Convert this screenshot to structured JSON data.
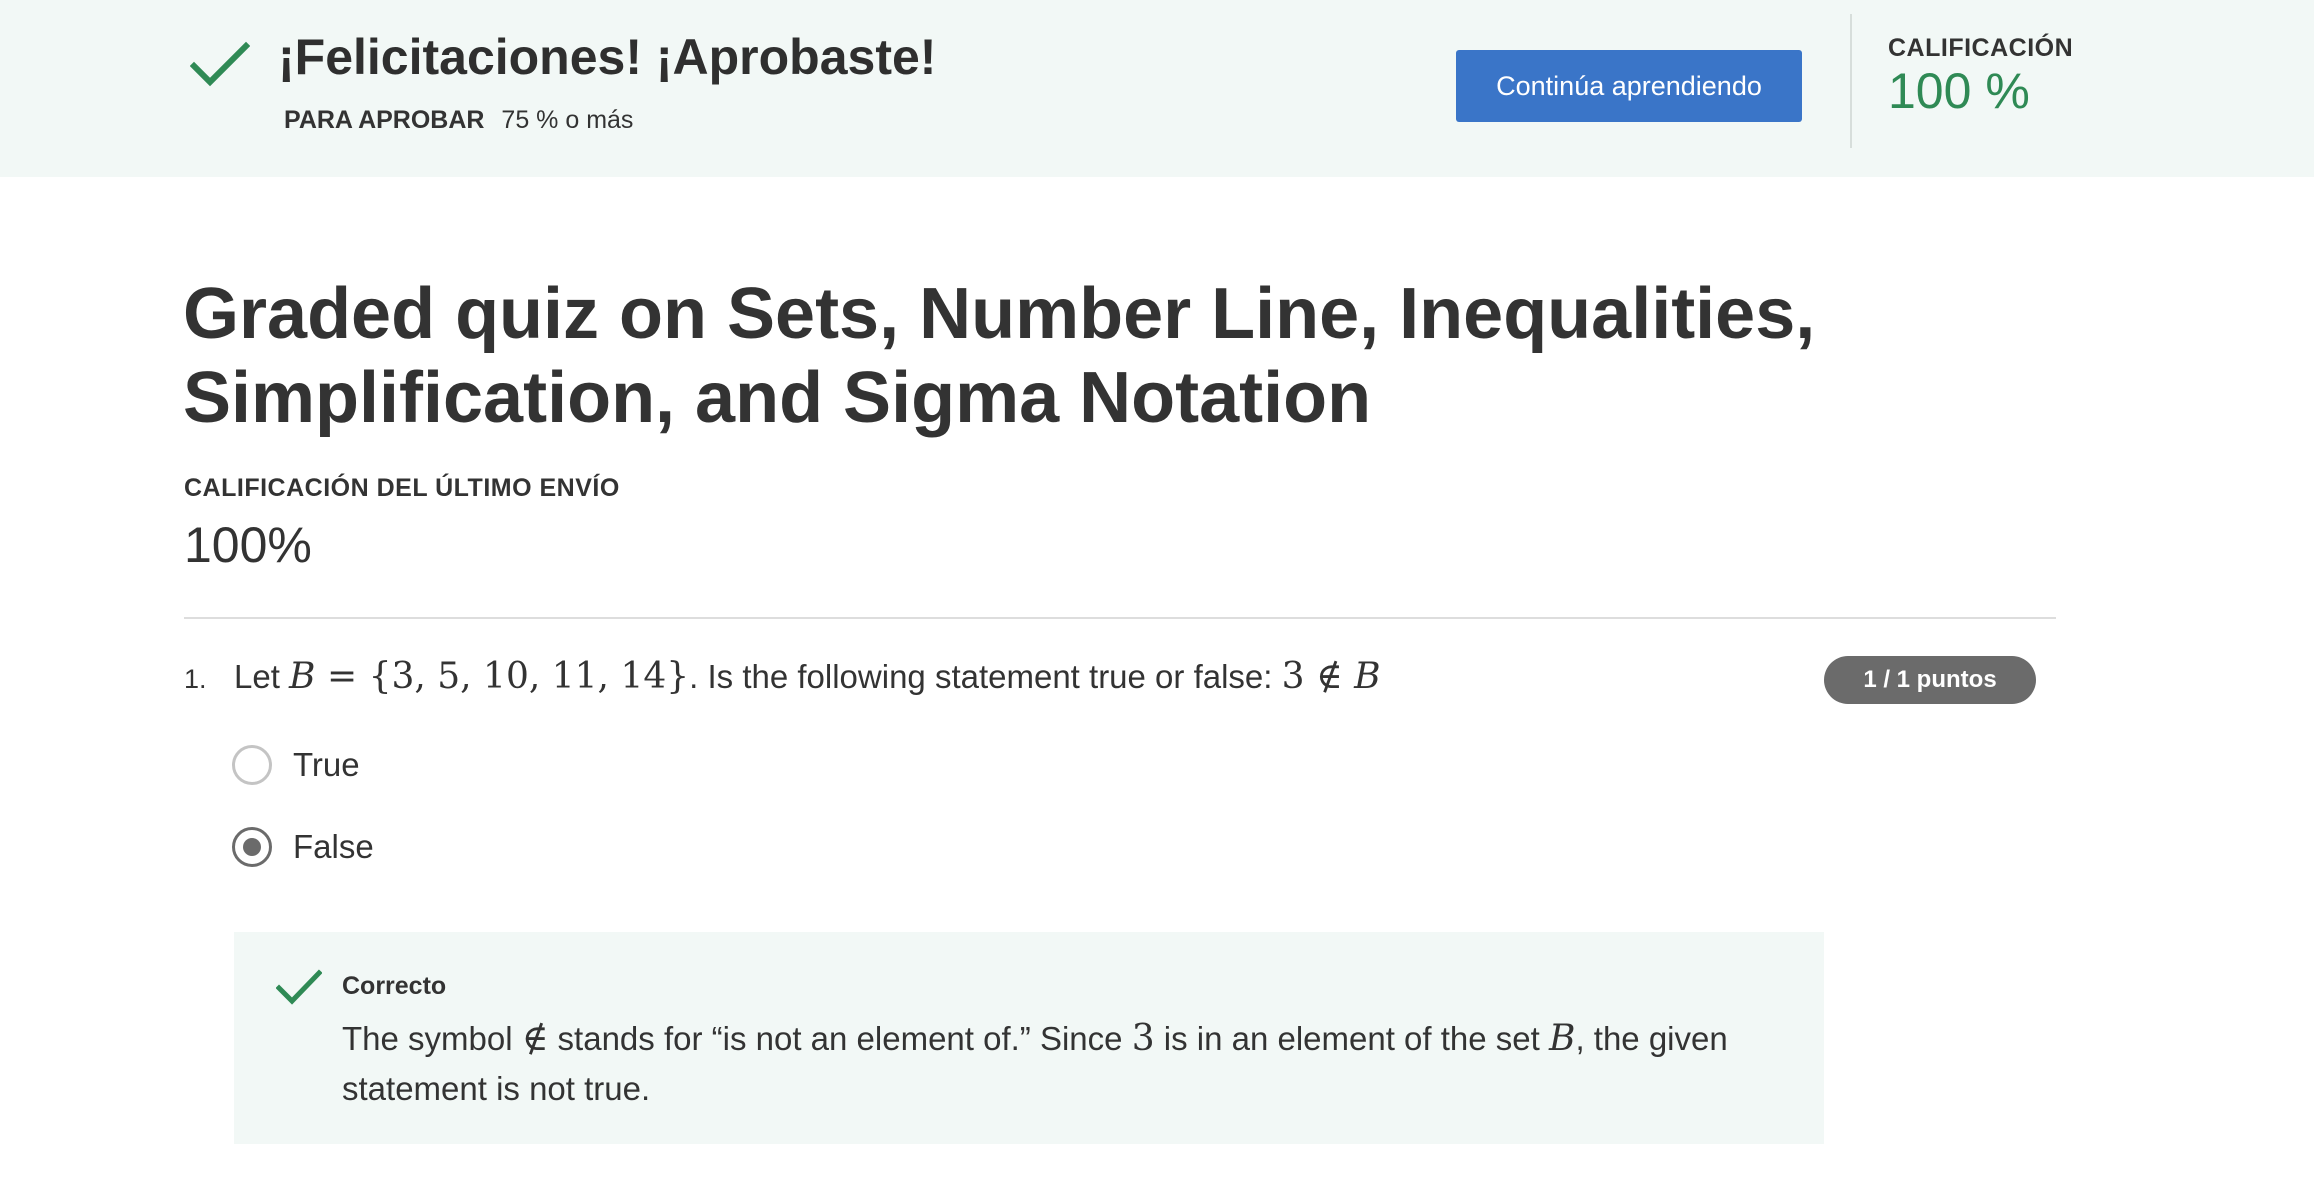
{
  "banner": {
    "title": "¡Felicitaciones! ¡Aprobaste!",
    "pass_label": "PARA APROBAR",
    "pass_value": "75 % o más",
    "continue_label": "Continúa aprendiendo",
    "grade_label": "CALIFICACIÓN",
    "grade_value": "100 %"
  },
  "quiz": {
    "title": "Graded quiz on Sets, Number Line, Inequalities, Simplification, and Sigma Notation",
    "last_grade_label": "CALIFICACIÓN DEL ÚLTIMO ENVÍO",
    "last_grade_value": "100%"
  },
  "question": {
    "number": "1.",
    "text_prefix": "Let ",
    "math_set_name": "B",
    "math_set_eq": " = {3, 5, 10, 11, 14}",
    "text_middle": ". Is the following statement true or false: ",
    "math_statement_num": "3",
    "math_statement_sym": " ∉ ",
    "math_statement_set": "B",
    "points": "1 / 1 puntos",
    "options": [
      {
        "label": "True",
        "selected": false
      },
      {
        "label": "False",
        "selected": true
      }
    ]
  },
  "feedback": {
    "label": "Correcto",
    "text_1": "The symbol ",
    "symbol": "∉",
    "text_2": " stands for “is not an element of.” Since ",
    "math_num": "3",
    "text_3": " is in an element of the set ",
    "math_set": "B",
    "text_4": ", the given statement is not true."
  },
  "colors": {
    "banner_bg": "#f2f8f6",
    "accent_green": "#2f8a55",
    "button_blue": "#3a75c8",
    "pill_gray": "#6b6b6b"
  },
  "icons": [
    "check-icon",
    "radio-unchecked-icon",
    "radio-checked-icon"
  ]
}
